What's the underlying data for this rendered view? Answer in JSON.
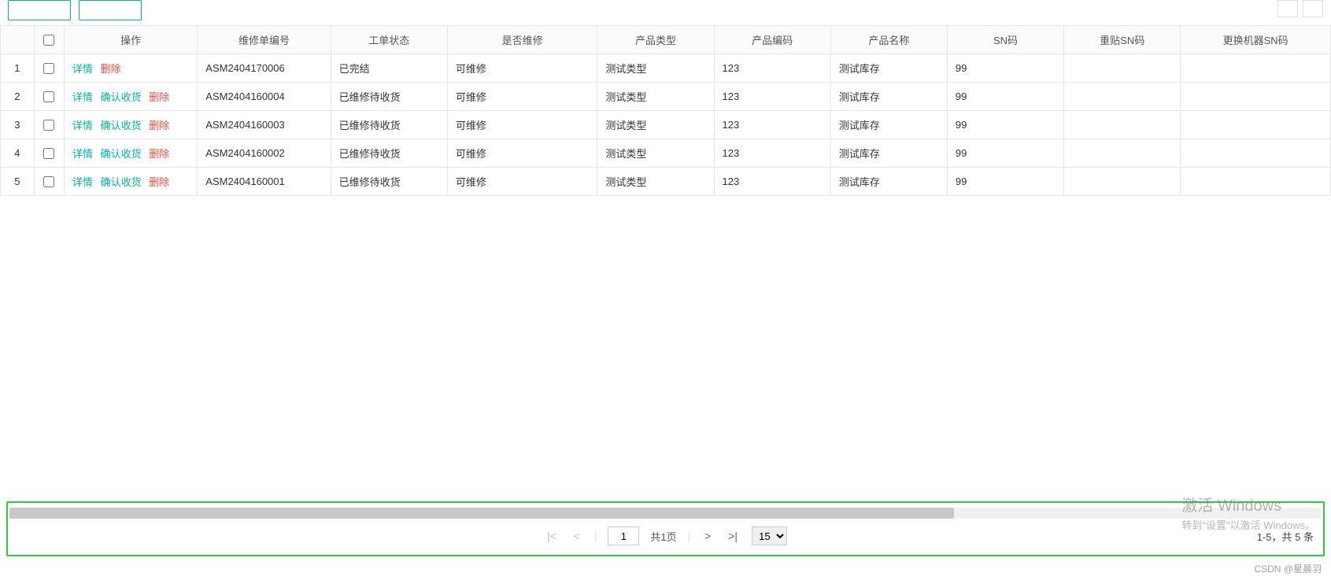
{
  "columns": {
    "op": "操作",
    "num": "维修单编号",
    "status": "工单状态",
    "repair": "是否维修",
    "type": "产品类型",
    "code": "产品编码",
    "name": "产品名称",
    "sn": "SN码",
    "resn": "重贴SN码",
    "replace": "更换机器SN码"
  },
  "actions": {
    "detail": "详情",
    "confirm": "确认收货",
    "delete": "删除"
  },
  "rows": [
    {
      "idx": "1",
      "num": "ASM2404170006",
      "status": "已完结",
      "repair": "可维修",
      "type": "测试类型",
      "code": "123",
      "name": "测试库存",
      "sn": "99",
      "resn": "",
      "replace": "",
      "hasConfirm": false
    },
    {
      "idx": "2",
      "num": "ASM2404160004",
      "status": "已维修待收货",
      "repair": "可维修",
      "type": "测试类型",
      "code": "123",
      "name": "测试库存",
      "sn": "99",
      "resn": "",
      "replace": "",
      "hasConfirm": true
    },
    {
      "idx": "3",
      "num": "ASM2404160003",
      "status": "已维修待收货",
      "repair": "可维修",
      "type": "测试类型",
      "code": "123",
      "name": "测试库存",
      "sn": "99",
      "resn": "",
      "replace": "",
      "hasConfirm": true
    },
    {
      "idx": "4",
      "num": "ASM2404160002",
      "status": "已维修待收货",
      "repair": "可维修",
      "type": "测试类型",
      "code": "123",
      "name": "测试库存",
      "sn": "99",
      "resn": "",
      "replace": "",
      "hasConfirm": true
    },
    {
      "idx": "5",
      "num": "ASM2404160001",
      "status": "已维修待收货",
      "repair": "可维修",
      "type": "测试类型",
      "code": "123",
      "name": "测试库存",
      "sn": "99",
      "resn": "",
      "replace": "",
      "hasConfirm": true
    }
  ],
  "pager": {
    "page": "1",
    "total_pages_label": "共1页",
    "page_size": "15",
    "summary": "1-5，共 5 条"
  },
  "watermark": {
    "title": "激活 Windows",
    "sub": "转到\"设置\"以激活 Windows。"
  },
  "credit": "CSDN @星晨羽"
}
